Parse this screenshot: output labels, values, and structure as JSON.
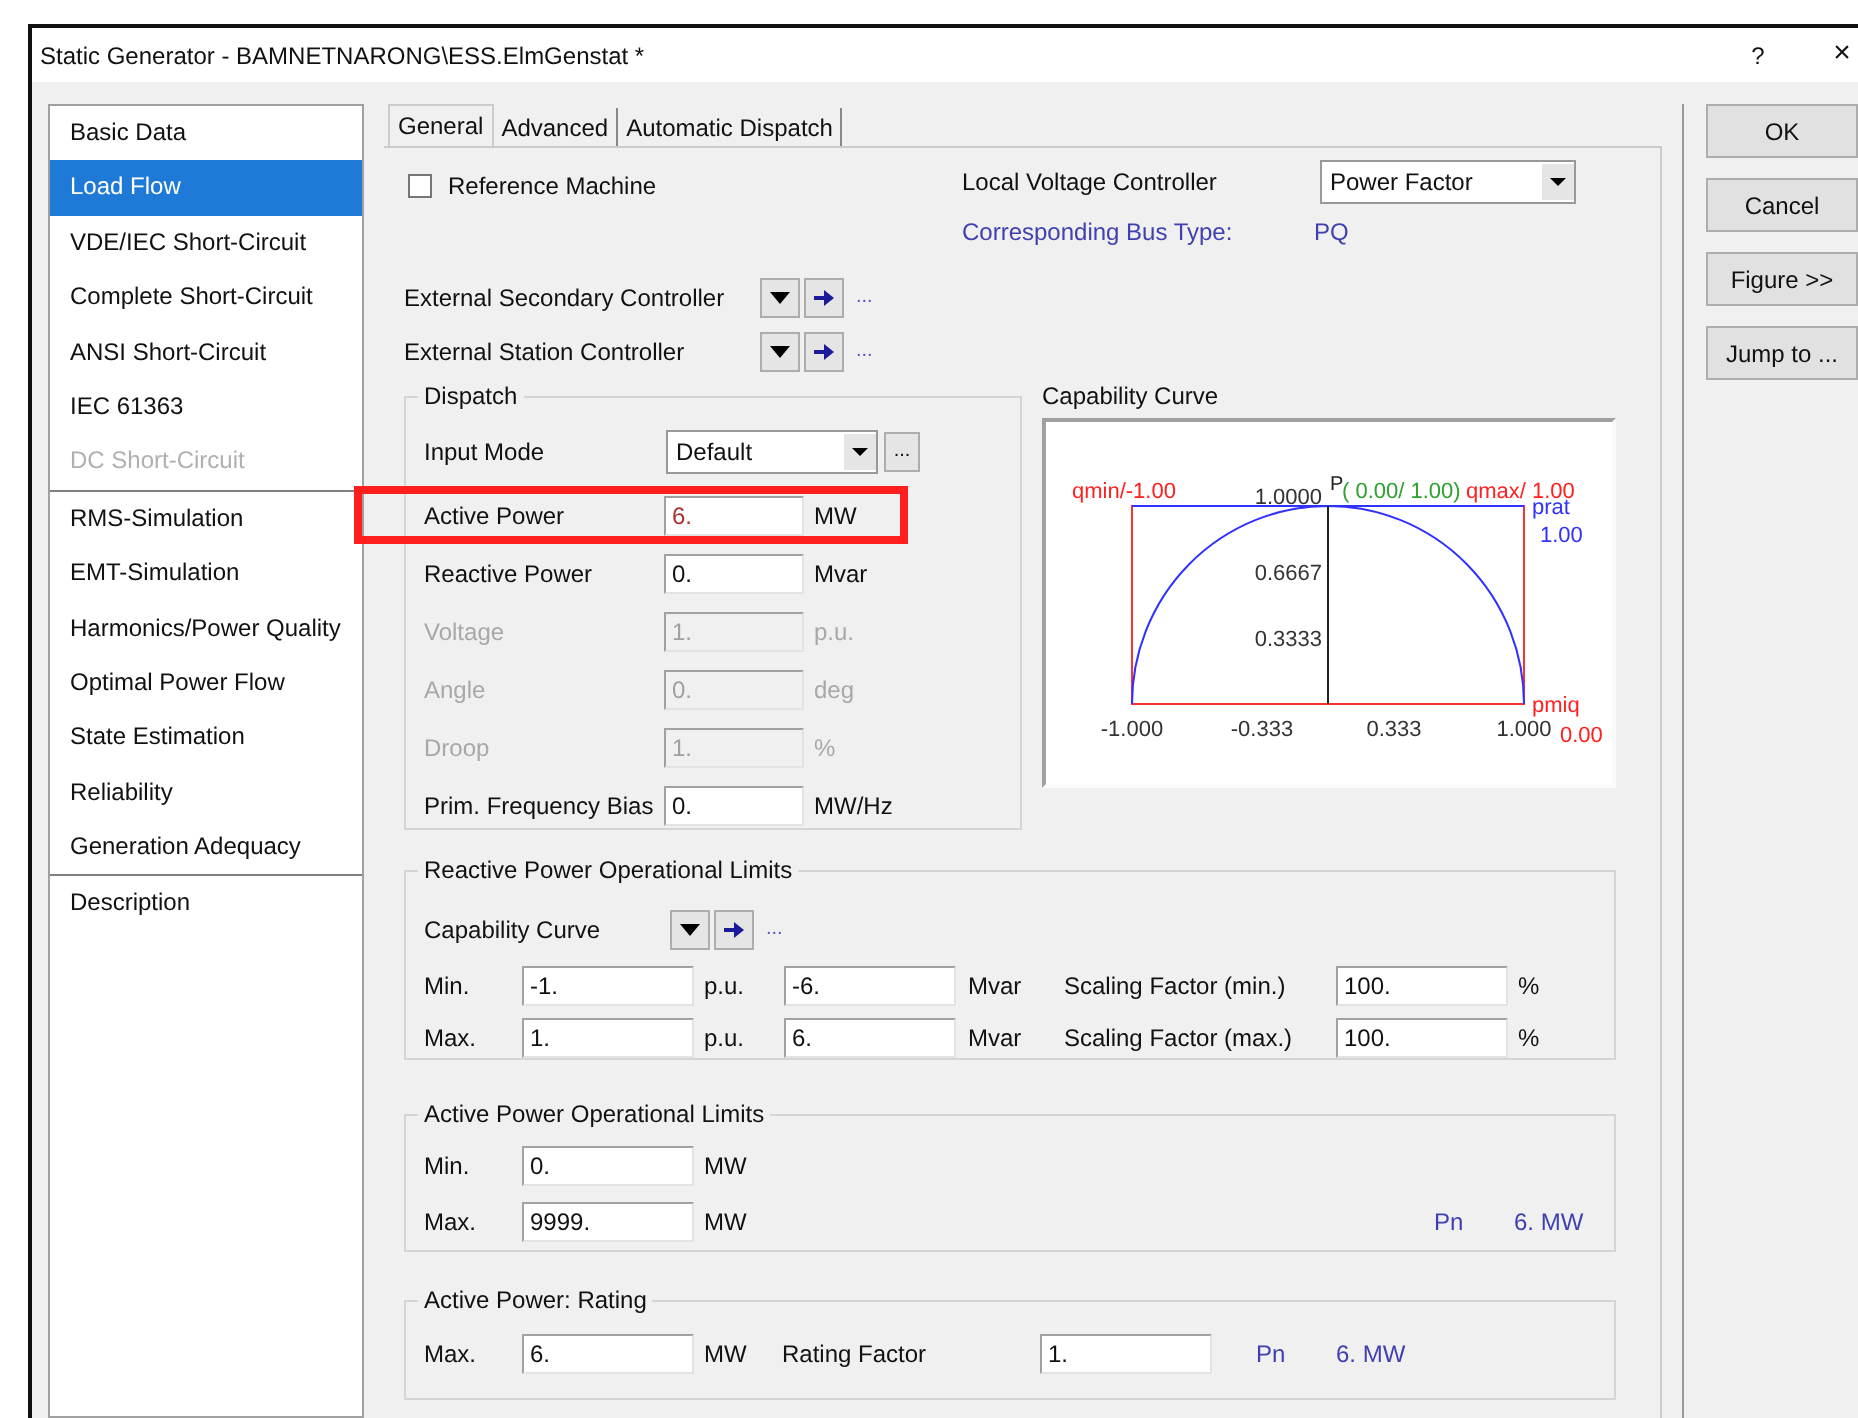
{
  "window": {
    "title": "Static Generator - BAMNETNARONG\\ESS.ElmGenstat *",
    "help": "?",
    "close": "×"
  },
  "sidebar": {
    "groups": [
      [
        {
          "label": "Basic Data",
          "selected": false,
          "disabled": false
        },
        {
          "label": "Load Flow",
          "selected": true,
          "disabled": false
        },
        {
          "label": "VDE/IEC Short-Circuit",
          "selected": false,
          "disabled": false
        },
        {
          "label": "Complete Short-Circuit",
          "selected": false,
          "disabled": false
        },
        {
          "label": "ANSI Short-Circuit",
          "selected": false,
          "disabled": false
        },
        {
          "label": "IEC 61363",
          "selected": false,
          "disabled": false
        },
        {
          "label": "DC Short-Circuit",
          "selected": false,
          "disabled": true
        }
      ],
      [
        {
          "label": "RMS-Simulation",
          "selected": false,
          "disabled": false
        },
        {
          "label": "EMT-Simulation",
          "selected": false,
          "disabled": false
        },
        {
          "label": "Harmonics/Power Quality",
          "selected": false,
          "disabled": false
        },
        {
          "label": "Optimal Power Flow",
          "selected": false,
          "disabled": false
        },
        {
          "label": "State Estimation",
          "selected": false,
          "disabled": false
        },
        {
          "label": "Reliability",
          "selected": false,
          "disabled": false
        },
        {
          "label": "Generation Adequacy",
          "selected": false,
          "disabled": false
        }
      ],
      [
        {
          "label": "Description",
          "selected": false,
          "disabled": false
        }
      ]
    ]
  },
  "tabs": [
    {
      "label": "General",
      "selected": true
    },
    {
      "label": "Advanced",
      "selected": false
    },
    {
      "label": "Automatic Dispatch",
      "selected": false
    }
  ],
  "reference_machine": {
    "label": "Reference Machine",
    "checked": false
  },
  "local_voltage_controller": {
    "label": "Local Voltage Controller",
    "value": "Power Factor"
  },
  "bus_type": {
    "label": "Corresponding Bus Type:",
    "value": "PQ"
  },
  "controllers": [
    {
      "label": "External Secondary Controller",
      "more": "..."
    },
    {
      "label": "External Station Controller",
      "more": "..."
    }
  ],
  "dispatch": {
    "title": "Dispatch",
    "input_mode": {
      "label": "Input Mode",
      "value": "Default",
      "more": "..."
    },
    "rows": [
      {
        "label": "Active Power",
        "value": "6.",
        "unit": "MW",
        "disabled": false,
        "highlighted": true
      },
      {
        "label": "Reactive Power",
        "value": "0.",
        "unit": "Mvar",
        "disabled": false,
        "highlighted": false
      },
      {
        "label": "Voltage",
        "value": "1.",
        "unit": "p.u.",
        "disabled": true,
        "highlighted": false
      },
      {
        "label": "Angle",
        "value": "0.",
        "unit": "deg",
        "disabled": true,
        "highlighted": false
      },
      {
        "label": "Droop",
        "value": "1.",
        "unit": "%",
        "disabled": true,
        "highlighted": false
      },
      {
        "label": "Prim. Frequency Bias",
        "value": "0.",
        "unit": "MW/Hz",
        "disabled": false,
        "highlighted": false
      }
    ]
  },
  "capability_curve": {
    "title": "Capability Curve",
    "qmin": "qmin/-1.00",
    "p": "P",
    "point": "( 0.00/ 1.00)",
    "qmax": "qmax/ 1.00",
    "prat": "prat",
    "prat_value": "1.00",
    "pmin": "pmiq",
    "pmin_value": "0.00",
    "yticks": [
      "1.0000",
      "0.6667",
      "0.3333"
    ],
    "xticks": [
      "-1.000",
      "-0.333",
      "0.333",
      "1.000"
    ]
  },
  "reactive_limits": {
    "title": "Reactive Power Operational Limits",
    "curve": {
      "label": "Capability Curve",
      "more": "..."
    },
    "rows": [
      {
        "label": "Min.",
        "pu": "-1.",
        "pu_unit": "p.u.",
        "mvar": "-6.",
        "mvar_unit": "Mvar",
        "scaling_label": "Scaling Factor (min.)",
        "scaling": "100.",
        "scaling_unit": "%"
      },
      {
        "label": "Max.",
        "pu": "1.",
        "pu_unit": "p.u.",
        "mvar": "6.",
        "mvar_unit": "Mvar",
        "scaling_label": "Scaling Factor (max.)",
        "scaling": "100.",
        "scaling_unit": "%"
      }
    ]
  },
  "active_limits": {
    "title": "Active Power Operational Limits",
    "rows": [
      {
        "label": "Min.",
        "value": "0.",
        "unit": "MW"
      },
      {
        "label": "Max.",
        "value": "9999.",
        "unit": "MW"
      }
    ],
    "pn_label": "Pn",
    "pn_value": "6. MW"
  },
  "rating": {
    "title": "Active Power: Rating",
    "label": "Max.",
    "value": "6.",
    "unit": "MW",
    "factor_label": "Rating Factor",
    "factor": "1.",
    "pn_label": "Pn",
    "pn_value": "6. MW"
  },
  "buttons": [
    "OK",
    "Cancel",
    "Figure >>",
    "Jump to ..."
  ]
}
